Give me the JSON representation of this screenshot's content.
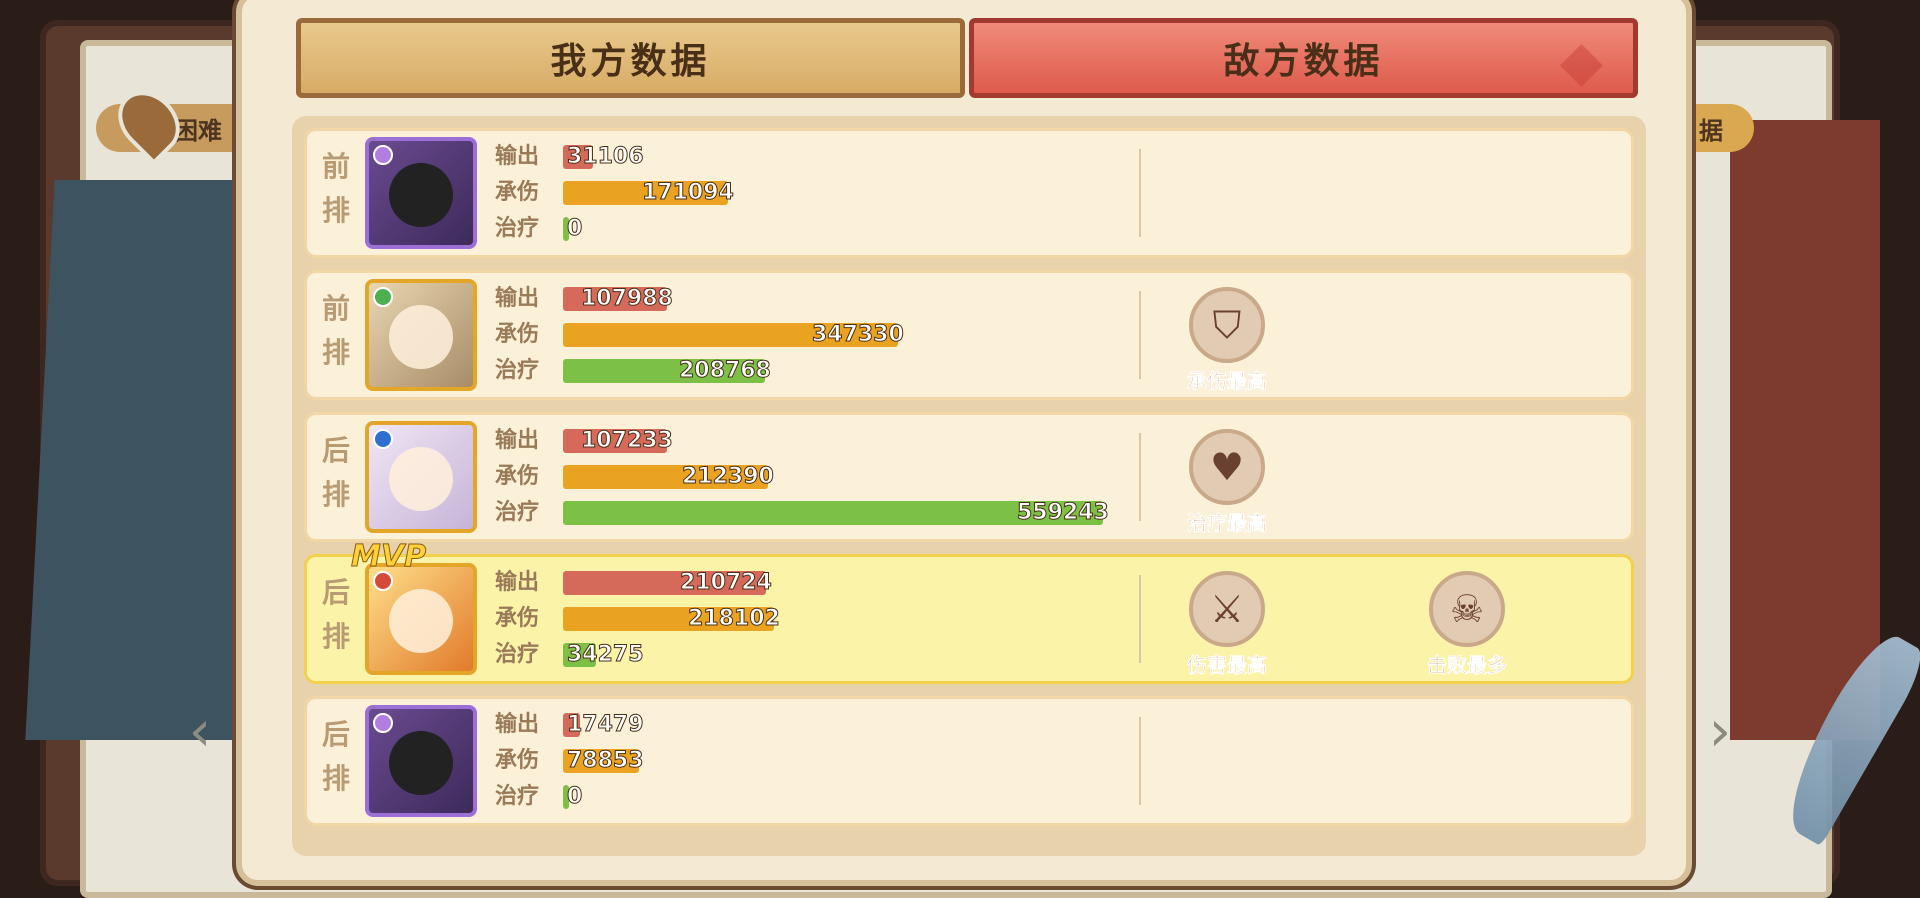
{
  "background": {
    "location_label": "困难",
    "right_chip_label": "据"
  },
  "tabs": {
    "ours": "我方数据",
    "enemy": "敌方数据"
  },
  "stat_labels": {
    "output": "输出",
    "damage_taken": "承伤",
    "healing": "治疗"
  },
  "scale_max": 559243,
  "awards": {
    "most_damage_taken": "承伤最高",
    "most_healing": "治疗最高",
    "most_damage": "伤害最高",
    "most_kills": "击败最多"
  },
  "mvp_label": "MVP",
  "heroes": [
    {
      "position": [
        "前",
        "排"
      ],
      "output": 31106,
      "taken": 171094,
      "healing": 0
    },
    {
      "position": [
        "前",
        "排"
      ],
      "output": 107988,
      "taken": 347330,
      "healing": 208768
    },
    {
      "position": [
        "后",
        "排"
      ],
      "output": 107233,
      "taken": 212390,
      "healing": 559243
    },
    {
      "position": [
        "后",
        "排"
      ],
      "output": 210724,
      "taken": 218102,
      "healing": 34275
    },
    {
      "position": [
        "后",
        "排"
      ],
      "output": 17479,
      "taken": 78853,
      "healing": 0
    }
  ],
  "colors": {
    "output_bar": "#d56a5a",
    "taken_bar": "#e9a321",
    "healing_bar": "#7cc046",
    "mvp_row": "#fbf3a8"
  }
}
